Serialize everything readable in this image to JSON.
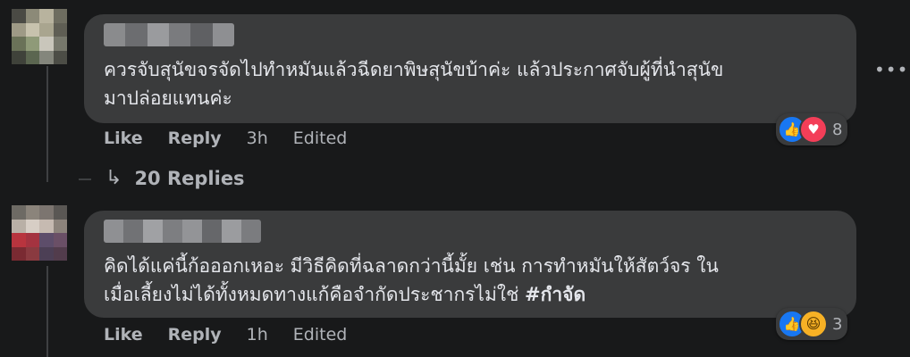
{
  "comments": [
    {
      "text_line1": "ควรจับสุนัขจรจัดไปทำหมันแล้วฉีดยาพิษสุนัขบ้าค่ะ แล้วประกาศจับผู้ที่นำสุนัข",
      "text_line2": "มาปล่อยแทนค่ะ",
      "like_label": "Like",
      "reply_label": "Reply",
      "time": "3h",
      "edited_label": "Edited",
      "reaction_count": "8",
      "reactions": [
        "like-icon",
        "love-icon"
      ],
      "replies_label": "20 Replies"
    },
    {
      "text_line1": "คิดได้แค่นี้ก้อออกเหอะ มีวิธีคิดที่ฉลาดกว่านี้มั้ย เช่น การทำหมันให้สัตว์จร ใน",
      "text_line2_prefix": "เมื่อเลี้ยงไม่ได้ทั้งหมดทางแก้คือจำกัดประชากรไม่ใช่ ",
      "hashtag": "#กำจัด",
      "like_label": "Like",
      "reply_label": "Reply",
      "time": "1h",
      "edited_label": "Edited",
      "reaction_count": "3",
      "reactions": [
        "like-icon",
        "haha-icon"
      ]
    }
  ],
  "more_options": "•••",
  "colors": {
    "background": "#18191a",
    "bubble": "#3a3b3c",
    "secondary_text": "#b0b3b8",
    "like_blue": "#1877f2",
    "love_red": "#f33e58",
    "haha_yellow": "#f7b125"
  }
}
